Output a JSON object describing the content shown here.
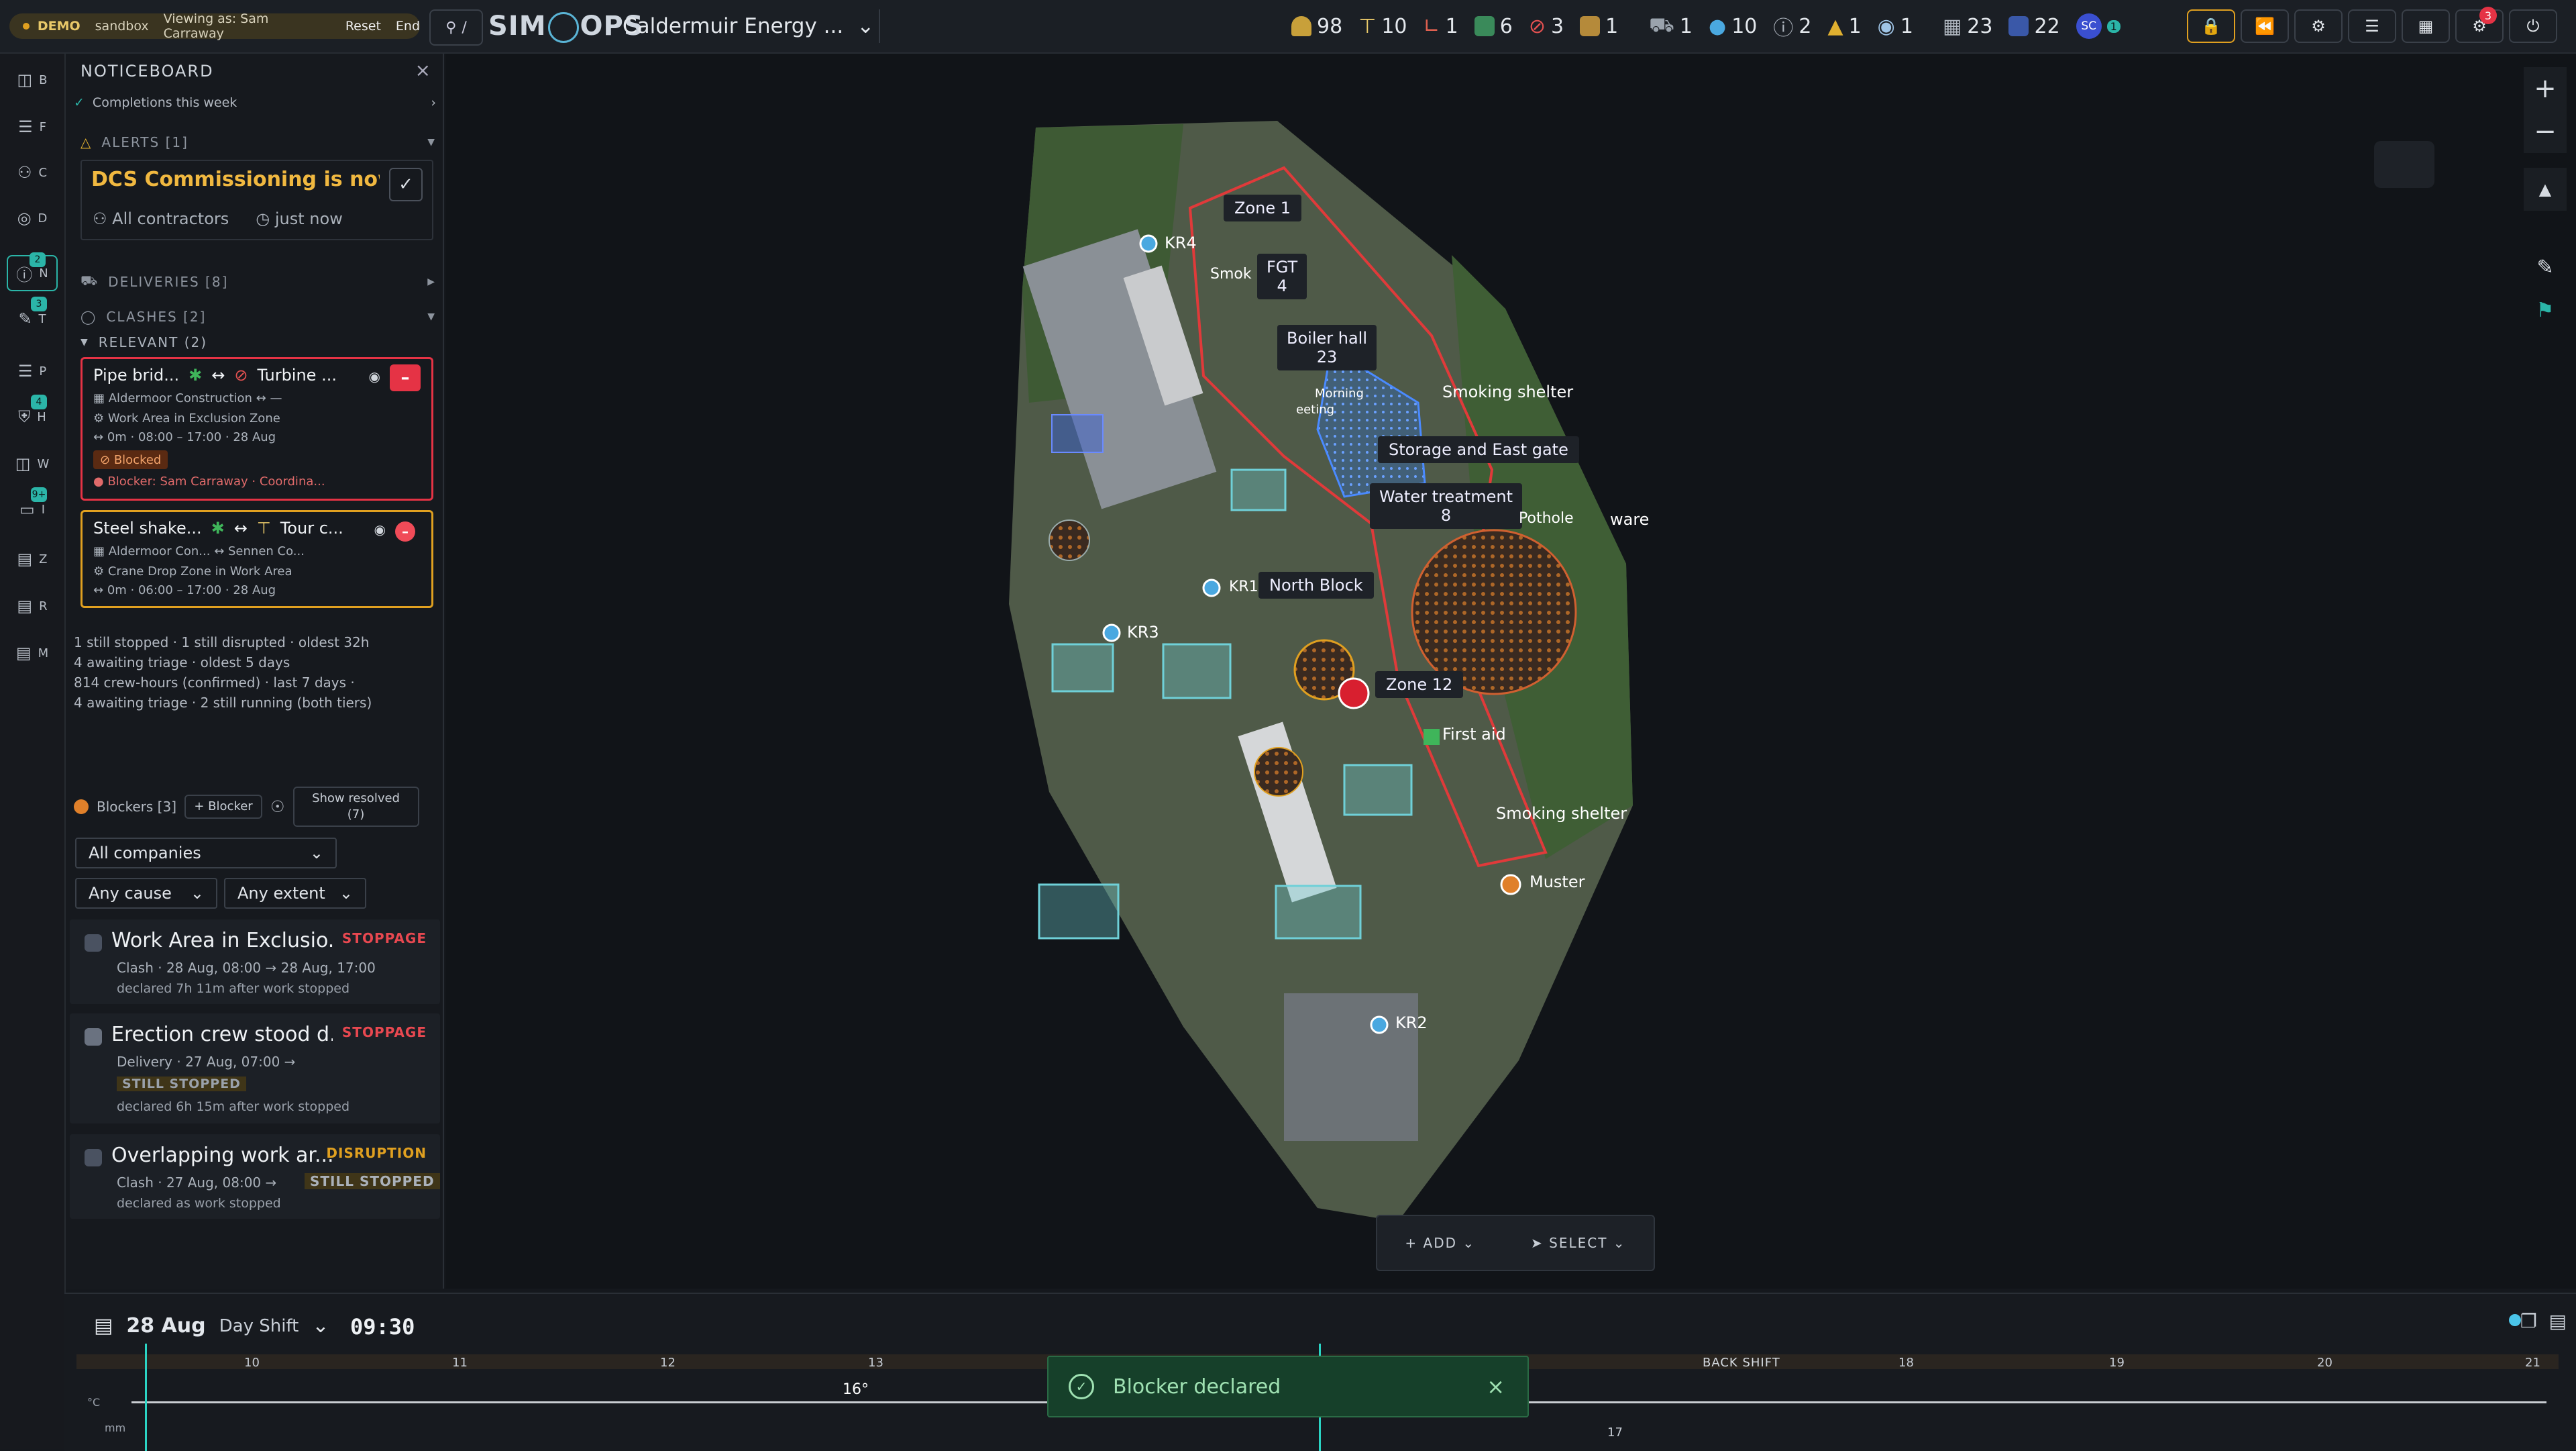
{
  "topbar": {
    "demo_label": "DEMO",
    "sandbox_label": "sandbox",
    "viewing_as": "Viewing as: Sam Carraway",
    "reset": "Reset",
    "end": "End",
    "search_label": "/",
    "brand_left": "SIM",
    "brand_right": "OPS",
    "project_name": "Caldermuir Energy ...",
    "counters": [
      "98",
      "10",
      "1",
      "6",
      "3",
      "1",
      "1",
      "10",
      "2",
      "1",
      "1",
      "23",
      "22"
    ],
    "user_initials": "SC",
    "user_badge": "1",
    "notif_badge": "3",
    "colors": {
      "accent": "#2bb5a8",
      "alert": "#e53345",
      "warn": "#e0a020"
    }
  },
  "rail": {
    "items": [
      {
        "letter": "B",
        "icon": "layers-icon"
      },
      {
        "letter": "F",
        "icon": "stack-icon"
      },
      {
        "letter": "C",
        "icon": "people-icon"
      },
      {
        "letter": "D",
        "icon": "compass-icon"
      },
      {
        "letter": "N",
        "icon": "alert-circle-icon",
        "badge": "2"
      },
      {
        "letter": "T",
        "icon": "pencil-icon",
        "badge": "3"
      },
      {
        "letter": "P",
        "icon": "clipboard-icon"
      },
      {
        "letter": "H",
        "icon": "shield-icon",
        "badge": "4"
      },
      {
        "letter": "W",
        "icon": "columns-icon"
      },
      {
        "letter": "I",
        "icon": "inbox-icon",
        "badge": "9+"
      },
      {
        "letter": "Z",
        "icon": "file-icon"
      },
      {
        "letter": "R",
        "icon": "report-icon"
      },
      {
        "letter": "M",
        "icon": "map-icon"
      }
    ]
  },
  "panel": {
    "title": "NOTICEBOARD",
    "completions": "Completions this week",
    "alerts_header": "ALERTS [1]",
    "alert": {
      "title": "DCS Commissioning is now ...",
      "audience": "All contractors",
      "time": "just now"
    },
    "deliveries_header": "DELIVERIES [8]",
    "clashes_header": "CLASHES [2]",
    "relevant_header": "RELEVANT (2)",
    "clash1": {
      "left": "Pipe brid...",
      "right": "Turbine ...",
      "company": "Aldermoor Construction",
      "company_right": "—",
      "area": "Work Area in Exclusion Zone",
      "times": "0m · 08:00 – 17:00 · 28 Aug",
      "status": "Blocked",
      "blocker": "Blocker: Sam Carraway · Coordina..."
    },
    "clash2": {
      "left": "Steel shake...",
      "right": "Tour c...",
      "company": "Aldermoor Con...",
      "company_right": "Sennen Co...",
      "area": "Crane Drop Zone in Work Area",
      "times": "0m · 06:00 – 17:00 · 28 Aug"
    },
    "stats": [
      "1 still stopped · 1 still disrupted · oldest 32h",
      "4 awaiting triage · oldest 5 days",
      "814 crew-hours (confirmed) · last 7 days ·",
      "4 awaiting triage · 2 still running (both tiers)"
    ],
    "blockers_label": "Blockers [3]",
    "add_blocker": "+ Blocker",
    "show_resolved": "Show resolved (7)",
    "filter_company": "All companies",
    "filter_cause": "Any cause",
    "filter_extent": "Any extent",
    "blockers": [
      {
        "title": "Work Area in Exclusio...",
        "tag": "STOPPAGE",
        "meta": "Clash · 28 Aug, 08:00 → 28 Aug, 17:00",
        "note": "declared 7h 11m after work stopped"
      },
      {
        "title": "Erection crew stood d...",
        "tag": "STOPPAGE",
        "meta": "Delivery · 27 Aug, 07:00 →",
        "status": "STILL STOPPED",
        "note": "declared 6h 15m after work stopped"
      },
      {
        "title": "Overlapping work ar...",
        "tag": "DISRUPTION",
        "meta": "Clash · 27 Aug, 08:00 →",
        "status": "STILL STOPPED",
        "note": "declared as work stopped"
      }
    ]
  },
  "map": {
    "labels": {
      "zone1": "Zone 1",
      "kr4": "KR4",
      "fgt": "FGT",
      "fgt_count": "4",
      "boiler": "Boiler hall",
      "boiler_count": "23",
      "smoking1": "Smoking shelter",
      "storage": "Storage and East gate",
      "water": "Water treatment",
      "water_count": "8",
      "pothole": "Pothole",
      "ware": "ware",
      "north_block": "North Block",
      "kr1": "KR1",
      "kr3": "KR3",
      "zone12": "Zone 12",
      "first_aid": "First aid",
      "smoking2": "Smoking shelter",
      "muster": "Muster",
      "kr2": "KR2",
      "morning": "Morning",
      "meeting": "eeting",
      "smok_short": "Smok"
    },
    "add_label": "ADD",
    "select_label": "SELECT"
  },
  "timeline": {
    "date": "28 Aug",
    "shift": "Day Shift",
    "time": "09:30",
    "hours": [
      "10",
      "11",
      "12",
      "13",
      "17",
      "18",
      "19",
      "20",
      "21"
    ],
    "back_shift": "BACK SHIFT",
    "temp": "16°",
    "temp_unit": "°C",
    "rain_unit": "mm"
  },
  "toast": {
    "message": "Blocker declared"
  }
}
